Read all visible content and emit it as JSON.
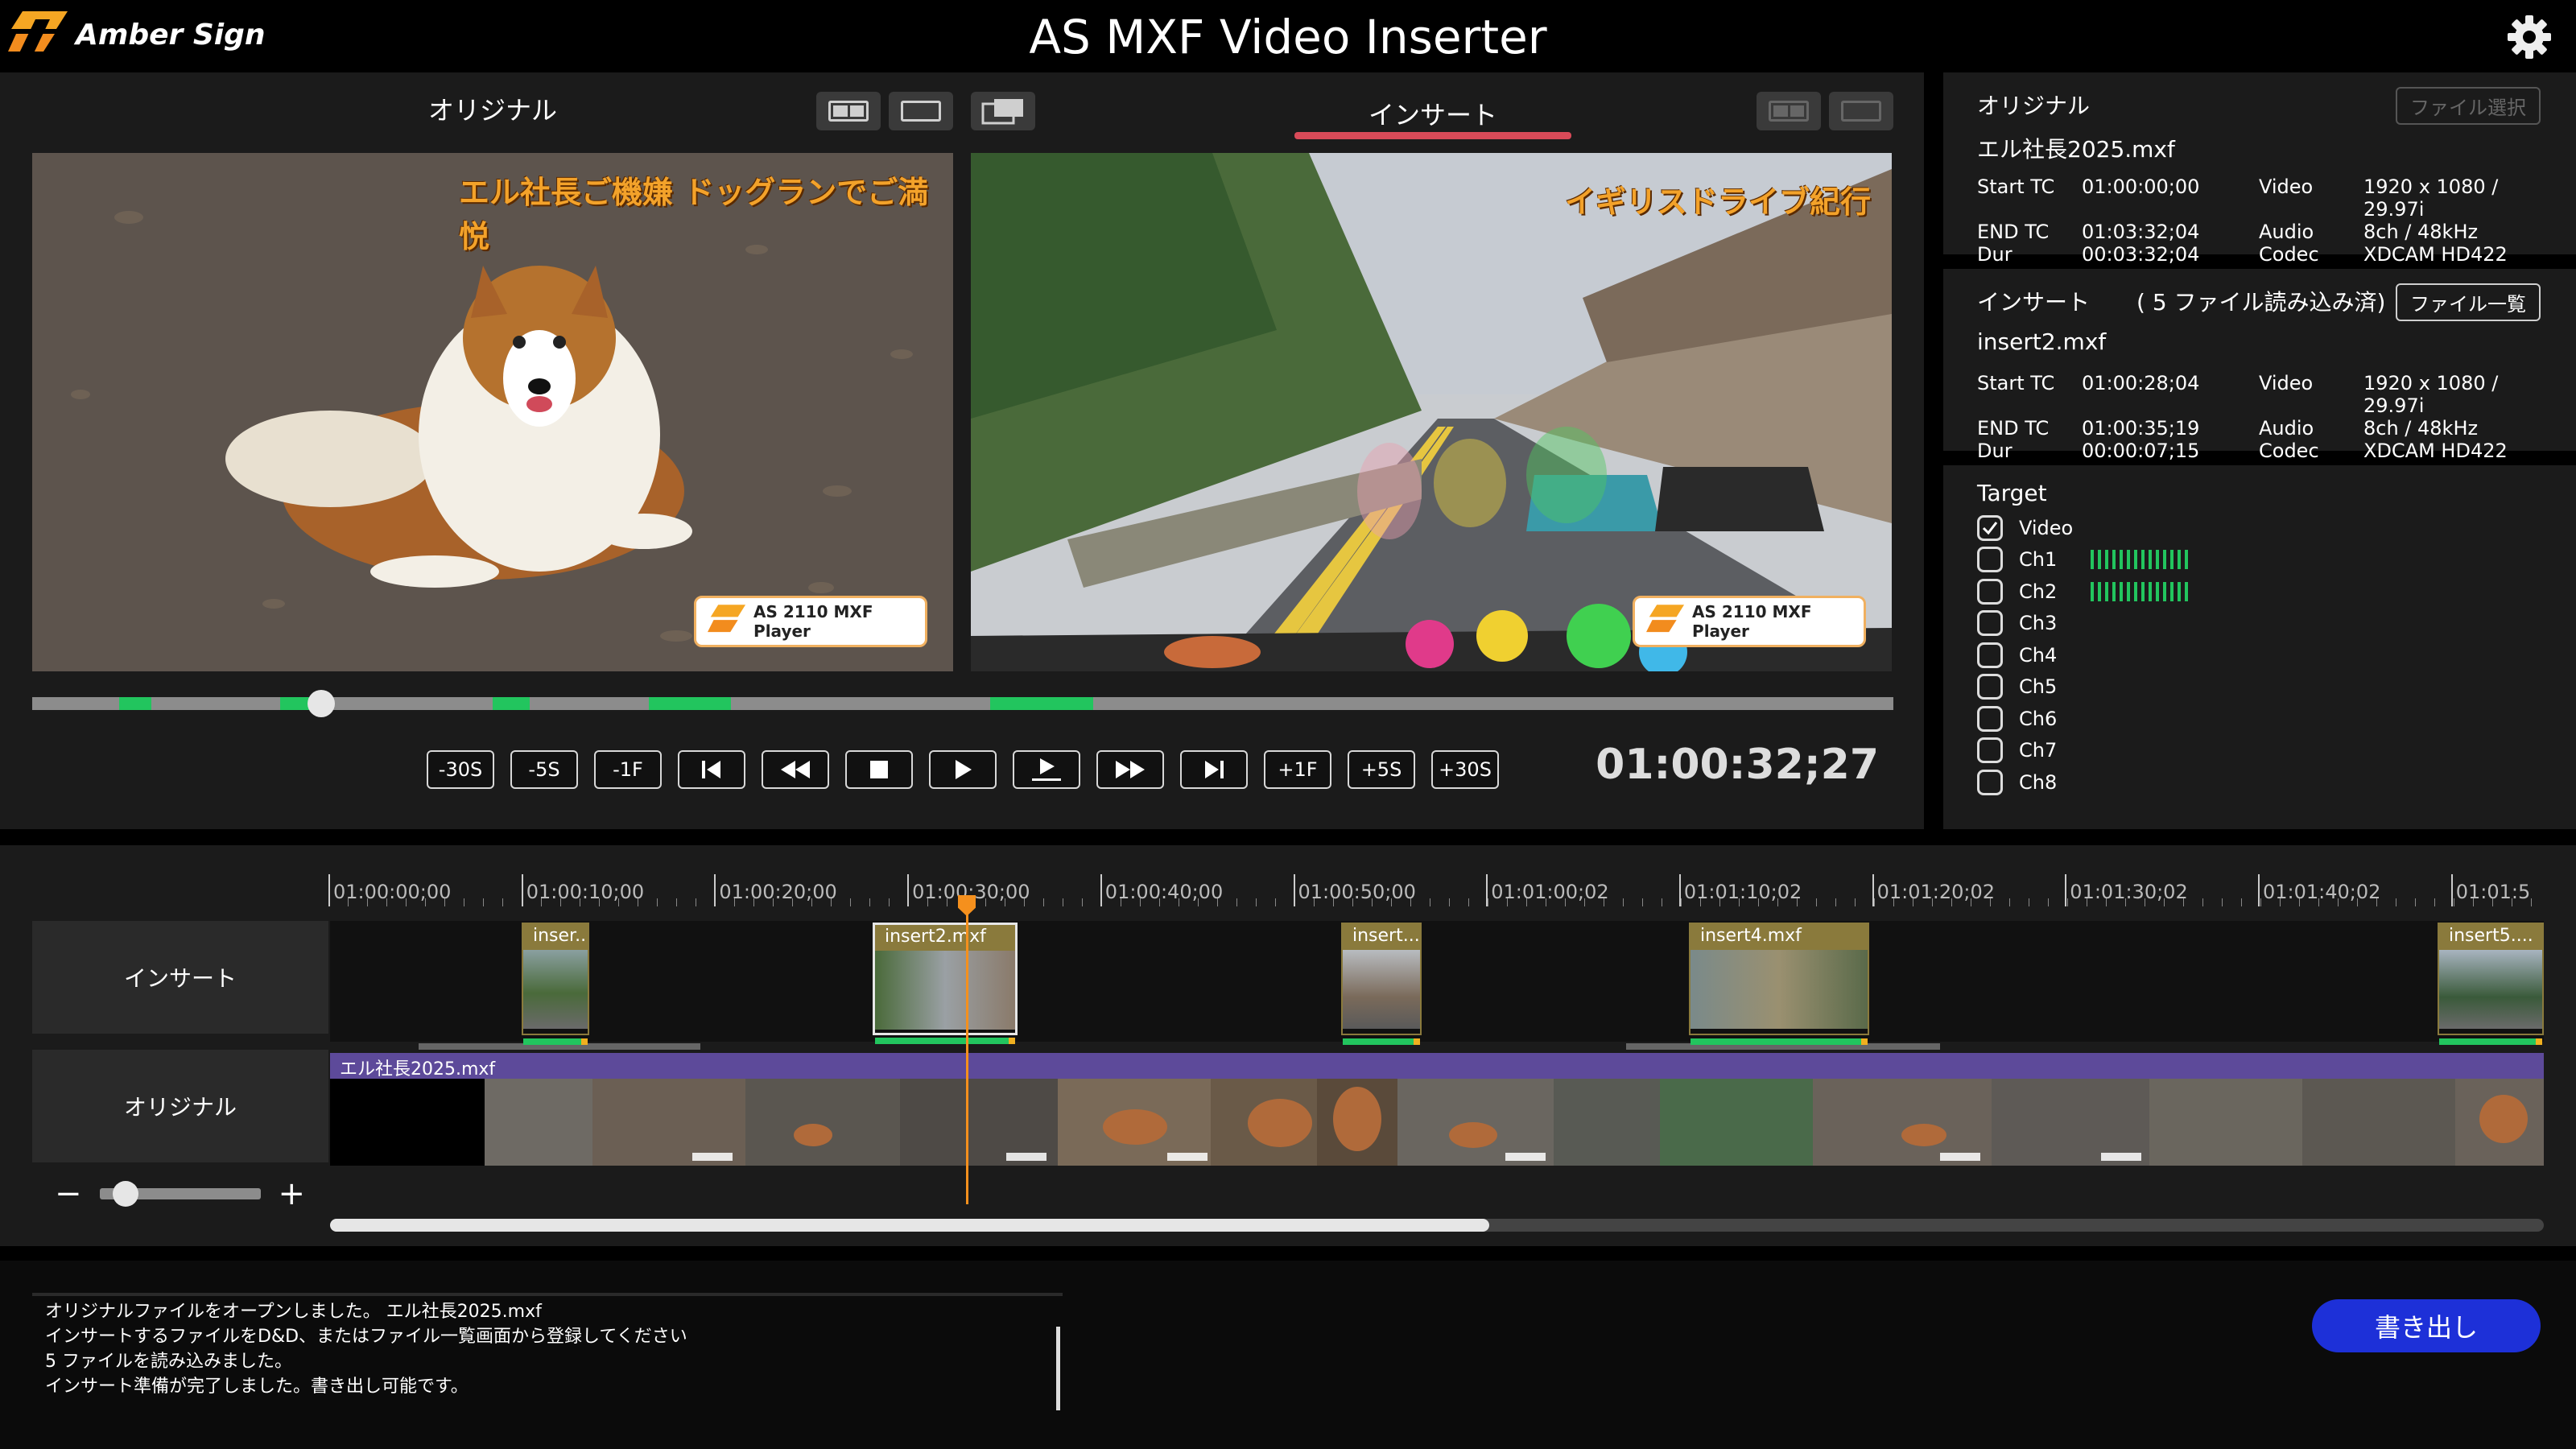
{
  "header": {
    "brand": "Amber Sign",
    "title": "AS MXF Video Inserter"
  },
  "colors": {
    "accent_green": "#22c55e",
    "playhead": "#f5901d",
    "export_blue": "#1d30d8",
    "tab_underline": "#d94a58"
  },
  "preview": {
    "left_label": "オリジナル",
    "right_label": "インサート",
    "left_caption": "エル社長ご機嫌 ドッグランでご満悦",
    "right_caption": "イギリスドライブ紀行",
    "badge_text": "AS 2110 MXF Player",
    "badge_brand": "Amber Sign",
    "timecode": "01:00:32;27",
    "controls": [
      "-30S",
      "-5S",
      "-1F",
      "skip-start-icon",
      "rewind-icon",
      "stop-icon",
      "play-icon",
      "play-marker-icon",
      "fast-forward-icon",
      "skip-end-icon",
      "+1F",
      "+5S",
      "+30S"
    ]
  },
  "original_info": {
    "title": "オリジナル",
    "select_button": "ファイル選択",
    "filename": "エル社長2025.mxf",
    "meta": [
      [
        "Start TC",
        "01:00:00;00",
        "Video",
        "1920 x 1080 / 29.97i"
      ],
      [
        "END TC",
        "01:03:32;04",
        "Audio",
        "8ch / 48kHz"
      ],
      [
        "Dur",
        "00:03:32;04",
        "Codec",
        "XDCAM HD422"
      ]
    ]
  },
  "insert_info": {
    "title": "インサート",
    "files_loaded": "( 5 ファイル読み込み済)",
    "list_button": "ファイル一覧",
    "filename": "insert2.mxf",
    "meta": [
      [
        "Start TC",
        "01:00:28;04",
        "Video",
        "1920 x 1080 / 29.97i"
      ],
      [
        "END TC",
        "01:00:35;19",
        "Audio",
        "8ch / 48kHz"
      ],
      [
        "Dur",
        "00:00:07;15",
        "Codec",
        "XDCAM HD422"
      ]
    ]
  },
  "target": {
    "title": "Target",
    "items": [
      {
        "label": "Video",
        "checked": true,
        "meter": false
      },
      {
        "label": "Ch1",
        "checked": false,
        "meter": true
      },
      {
        "label": "Ch2",
        "checked": false,
        "meter": true
      },
      {
        "label": "Ch3",
        "checked": false,
        "meter": false
      },
      {
        "label": "Ch4",
        "checked": false,
        "meter": false
      },
      {
        "label": "Ch5",
        "checked": false,
        "meter": false
      },
      {
        "label": "Ch6",
        "checked": false,
        "meter": false
      },
      {
        "label": "Ch7",
        "checked": false,
        "meter": false
      },
      {
        "label": "Ch8",
        "checked": false,
        "meter": false
      }
    ]
  },
  "timeline": {
    "ruler": [
      "01:00:00;00",
      "01:00:10;00",
      "01:00:20;00",
      "01:00:30;00",
      "01:00:40;00",
      "01:00:50;00",
      "01:01:00;02",
      "01:01:10;02",
      "01:01:20;02",
      "01:01:30;02",
      "01:01:40;02",
      "01:01:5"
    ],
    "insert_track_label": "インサート",
    "original_track_label": "オリジナル",
    "original_clip_name": "エル社長2025.mxf",
    "clips": [
      "inser...",
      "insert2.mxf",
      "insert...",
      "insert4.mxf",
      "insert5...."
    ],
    "selected_clip": "insert2.mxf"
  },
  "log": {
    "lines": [
      "オリジナルファイルをオープンしました。 エル社長2025.mxf",
      "インサートするファイルをD&D、またはファイル一覧画面から登録してください",
      "5 ファイルを読み込みました。",
      "インサート準備が完了しました。書き出し可能です。"
    ],
    "export_button": "書き出し"
  }
}
